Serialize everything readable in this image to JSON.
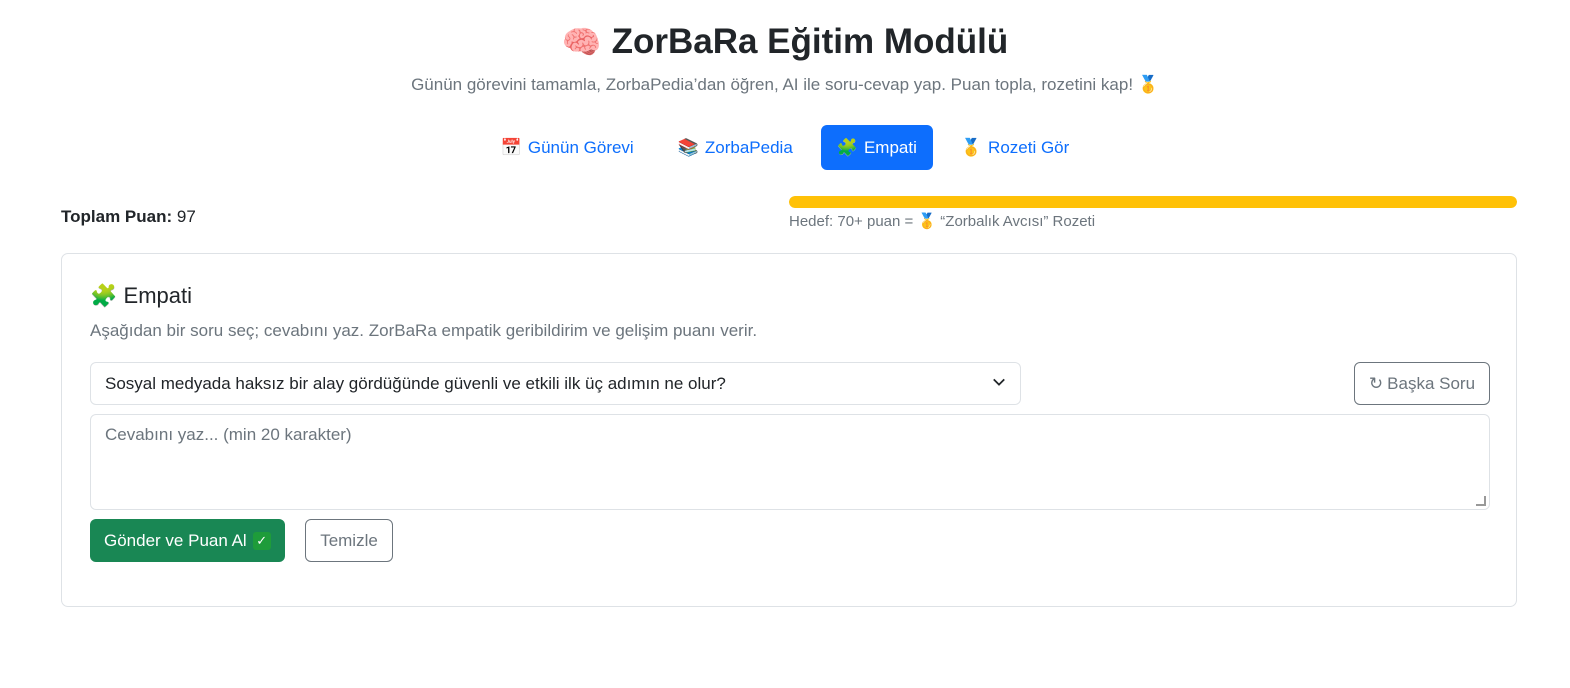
{
  "header": {
    "title_icon": "🧠",
    "title": "ZorBaRa Eğitim Modülü",
    "subtitle": "Günün görevini tamamla, ZorbaPedia’dan öğren, AI ile soru-cevap yap. Puan topla, rozetini kap! 🥇"
  },
  "tabs": [
    {
      "icon": "📅",
      "icon_name": "calendar-icon",
      "label": "Günün Görevi",
      "active": false
    },
    {
      "icon": "📚",
      "icon_name": "books-icon",
      "label": "ZorbaPedia",
      "active": false
    },
    {
      "icon": "🧩",
      "icon_name": "puzzle-icon",
      "label": "Empati",
      "active": true
    },
    {
      "icon": "🥇",
      "icon_name": "medal-icon",
      "label": "Rozeti Gör",
      "active": false
    }
  ],
  "score": {
    "label": "Toplam Puan:",
    "value": "97",
    "progress_fraction": 1.0,
    "goal_text": "Hedef: 70+ puan = 🥇 “Zorbalık Avcısı” Rozeti",
    "progress_color": "#ffc107"
  },
  "card": {
    "title_icon": "🧩",
    "title": "Empati",
    "description": "Aşağıdan bir soru seç; cevabını yaz. ZorBaRa empatik geribildirim ve gelişim puanı verir.",
    "question_select": "Sosyal medyada haksız bir alay gördüğünde güvenli ve etkili ilk üç adımın ne olur?",
    "another_button": "Başka Soru",
    "answer_placeholder": "Cevabını yaz... (min 20 karakter)",
    "submit_button": "Gönder ve Puan Al",
    "clear_button": "Temizle"
  },
  "colors": {
    "primary": "#0d6efd",
    "success": "#198754",
    "muted": "#6c757d"
  }
}
